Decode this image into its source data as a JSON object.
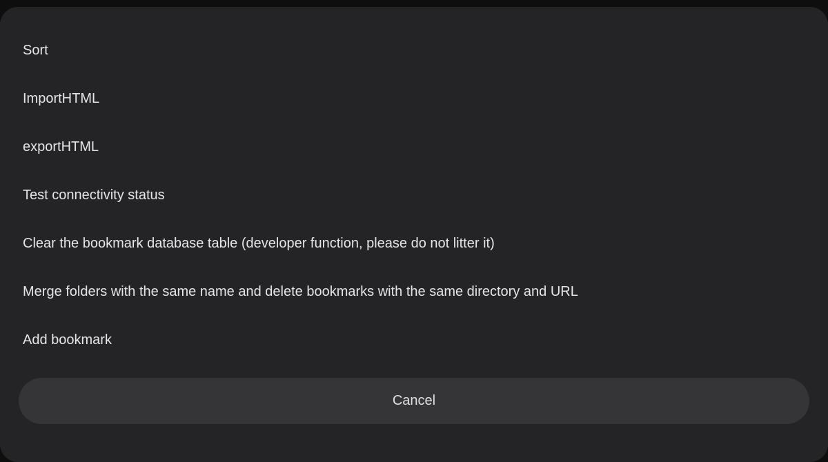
{
  "menu": {
    "items": [
      {
        "label": "Sort"
      },
      {
        "label": "ImportHTML"
      },
      {
        "label": "exportHTML"
      },
      {
        "label": "Test connectivity status"
      },
      {
        "label": "Clear the bookmark database table (developer function, please do not litter it)"
      },
      {
        "label": "Merge folders with the same name and delete bookmarks with the same directory and URL"
      },
      {
        "label": "Add bookmark"
      }
    ]
  },
  "actions": {
    "cancel_label": "Cancel"
  },
  "colors": {
    "backdrop": "#0e0e0f",
    "sheet": "#242426",
    "button": "#353537",
    "text": "#e6e6e6"
  }
}
